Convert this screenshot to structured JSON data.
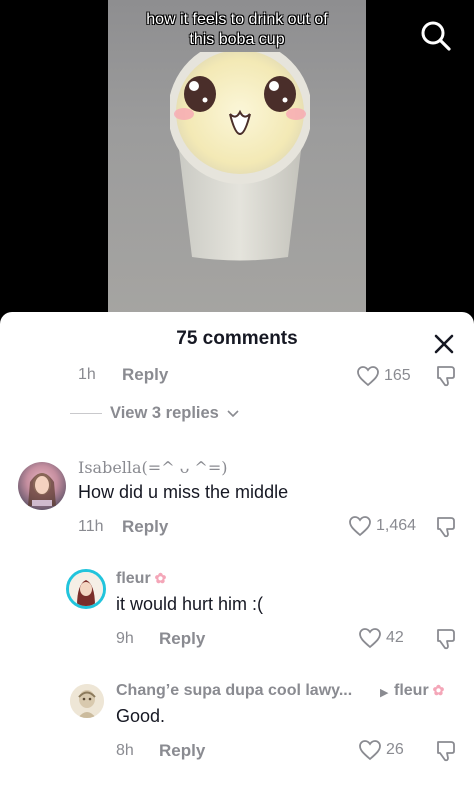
{
  "video": {
    "caption_line1": "how it feels to drink out of",
    "caption_line2": "this boba cup"
  },
  "sheet": {
    "title": "75 comments"
  },
  "previous_comment": {
    "time": "1h",
    "reply_label": "Reply",
    "likes": "165"
  },
  "view_replies": {
    "label": "View 3 replies"
  },
  "comments": [
    {
      "username": "Isabella(=^ ᴗ ^=)",
      "text": "How did u miss the middle",
      "time": "11h",
      "reply_label": "Reply",
      "likes": "1,464"
    },
    {
      "username": "fleur",
      "text": "it would hurt him :(",
      "time": "9h",
      "reply_label": "Reply",
      "likes": "42"
    },
    {
      "username": "Chang’e supa dupa cool lawy...",
      "reply_to": "fleur",
      "text": "Good.",
      "time": "8h",
      "reply_label": "Reply",
      "likes": "26"
    }
  ],
  "icons": {
    "search": "search-icon",
    "close": "close-icon",
    "heart": "heart-icon",
    "dislike": "dislike-icon",
    "chevron": "chevron-down-icon",
    "flower": "flower-icon",
    "arrow": "reply-arrow-icon"
  },
  "colors": {
    "text_primary": "#161823",
    "text_secondary": "#8a8b91",
    "accent_flower": "#f4a6b8",
    "avatar_ring": "#21c4dc"
  }
}
